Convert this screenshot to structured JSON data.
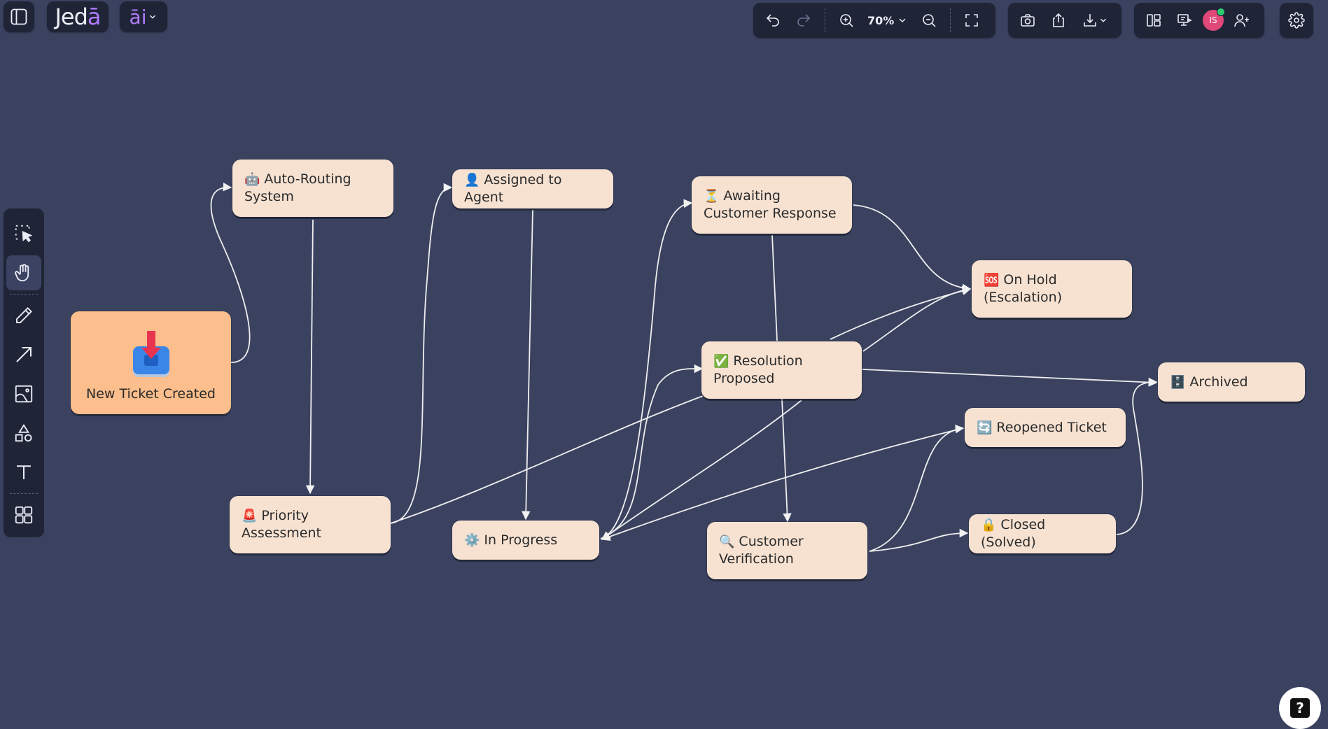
{
  "app": {
    "logo_main": "Jed",
    "logo_accent": "ā",
    "ai_label": "āi"
  },
  "toolbar": {
    "zoom_level": "70%"
  },
  "user": {
    "initials": "IS"
  },
  "nodes": [
    {
      "id": "new-ticket",
      "emoji": "📥",
      "label": "New Ticket Created"
    },
    {
      "id": "auto-routing",
      "emoji": "🤖",
      "label": "Auto-Routing System"
    },
    {
      "id": "priority",
      "emoji": "🚨",
      "label": "Priority Assessment"
    },
    {
      "id": "assigned",
      "emoji": "👤",
      "label": "Assigned to Agent"
    },
    {
      "id": "in-progress",
      "emoji": "⚙️",
      "label": "In Progress"
    },
    {
      "id": "awaiting",
      "emoji": "⏳",
      "label": "Awaiting Customer Response"
    },
    {
      "id": "resolution",
      "emoji": "✅",
      "label": "Resolution Proposed"
    },
    {
      "id": "verification",
      "emoji": "🔍",
      "label": "Customer Verification"
    },
    {
      "id": "on-hold",
      "emoji": "🆘",
      "label": "On Hold (Escalation)"
    },
    {
      "id": "archived",
      "emoji": "🗄️",
      "label": "Archived"
    },
    {
      "id": "reopened",
      "emoji": "🔄",
      "label": "Reopened Ticket"
    },
    {
      "id": "closed",
      "emoji": "🔒",
      "label": "Closed (Solved)"
    }
  ],
  "help": {
    "glyph": "?"
  }
}
